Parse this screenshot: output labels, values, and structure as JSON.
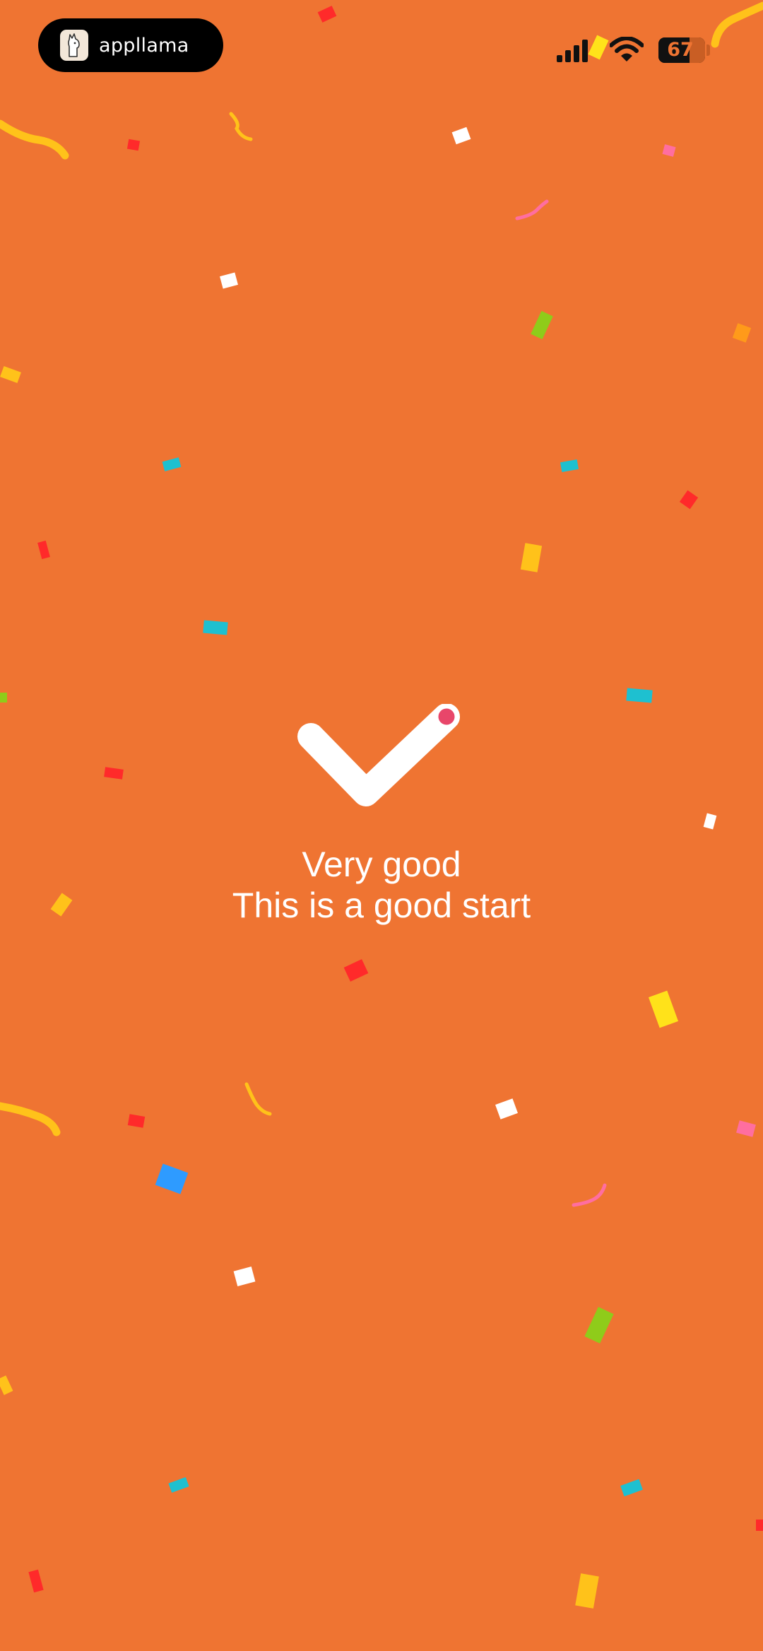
{
  "status_bar": {
    "app_name": "appllama",
    "app_icon": "llama-icon",
    "battery_level": 67,
    "battery_label": "67",
    "icons": [
      "signal-icon",
      "wifi-icon",
      "battery-icon"
    ]
  },
  "result": {
    "title": "Very good",
    "subtitle": "This is a good start",
    "icon": "checkmark-icon"
  },
  "colors": {
    "background": "#EF7432",
    "text": "#FFFFFF",
    "accent_dot": "#E8466A",
    "confetti": [
      "#FF2A2A",
      "#FFFFFF",
      "#FFC21A",
      "#1EC0D0",
      "#8FCC1A",
      "#FF6EA0",
      "#2E9BFF",
      "#FFE21A",
      "#FF9A1A"
    ]
  }
}
